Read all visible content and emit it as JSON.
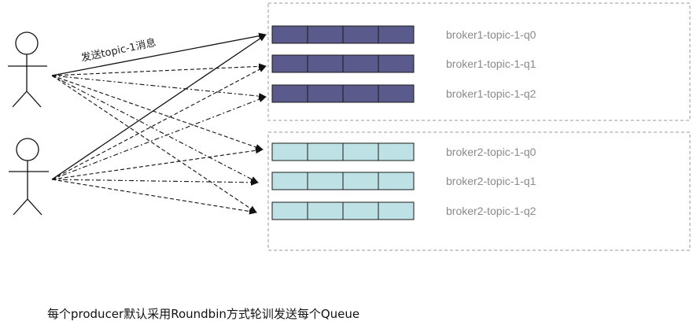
{
  "send_label": "发送topic-1消息",
  "caption": "每个producer默认采用Roundbin方式轮训发送每个Queue",
  "brokers": [
    {
      "queues": [
        "broker1-topic-1-q0",
        "broker1-topic-1-q1",
        "broker1-topic-1-q2"
      ],
      "fill": "#5a5a8c"
    },
    {
      "queues": [
        "broker2-topic-1-q0",
        "broker2-topic-1-q1",
        "broker2-topic-1-q2"
      ],
      "fill": "#bde1e4"
    }
  ],
  "colors": {
    "cell_border": "#1a1a1a",
    "group_border": "#999999",
    "arrow": "#111111"
  }
}
